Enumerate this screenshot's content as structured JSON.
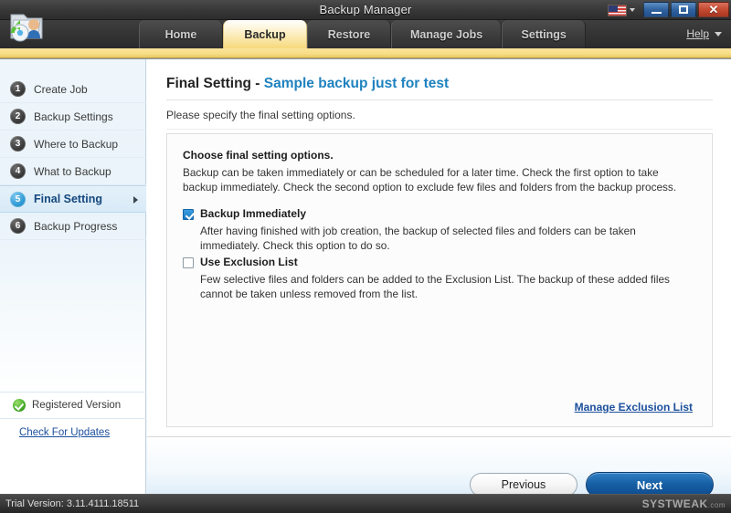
{
  "window": {
    "title": "Backup Manager",
    "minimize_label": "Minimize",
    "maximize_label": "Maximize",
    "close_label": "Close",
    "language_flag": "us-flag-icon"
  },
  "nav": {
    "tabs": [
      {
        "label": "Home",
        "active": false
      },
      {
        "label": "Backup",
        "active": true
      },
      {
        "label": "Restore",
        "active": false
      },
      {
        "label": "Manage Jobs",
        "active": false
      },
      {
        "label": "Settings",
        "active": false
      }
    ],
    "help_label": "Help"
  },
  "sidebar": {
    "steps": [
      {
        "num": "1",
        "label": "Create Job"
      },
      {
        "num": "2",
        "label": "Backup Settings"
      },
      {
        "num": "3",
        "label": "Where to Backup"
      },
      {
        "num": "4",
        "label": "What to Backup"
      },
      {
        "num": "5",
        "label": "Final Setting"
      },
      {
        "num": "6",
        "label": "Backup Progress"
      }
    ],
    "registered_label": "Registered Version",
    "updates_label": "Check For Updates"
  },
  "content": {
    "title_primary": "Final Setting - ",
    "title_accent": "Sample backup just for test",
    "subtitle": "Please specify the final setting options.",
    "panel_heading": "Choose final setting options.",
    "panel_description": "Backup can be taken immediately or can be scheduled for a later time. Check the first option to take backup immediately. Check the second option to exclude few files and folders from the backup process.",
    "options": [
      {
        "label": "Backup Immediately",
        "checked": true,
        "description": "After having finished with job creation, the backup of selected files and folders can be taken immediately. Check this option to do so."
      },
      {
        "label": "Use Exclusion List",
        "checked": false,
        "description": "Few selective files and folders can be added to the Exclusion List. The backup of these added files cannot be taken unless removed from the list."
      }
    ],
    "exclusion_link": "Manage Exclusion List"
  },
  "footer": {
    "previous_label": "Previous",
    "next_label": "Next"
  },
  "status": {
    "version_text": "Trial Version: 3.11.4111.18511",
    "watermark": "SYSTWEAK",
    "watermark_sub": ".com"
  },
  "colors": {
    "tab_active": "#f7d97c",
    "accent_blue": "#1f82bf",
    "link_blue": "#1b4f9c",
    "next_button": "#1760a6",
    "registered_green": "#46ab27"
  }
}
